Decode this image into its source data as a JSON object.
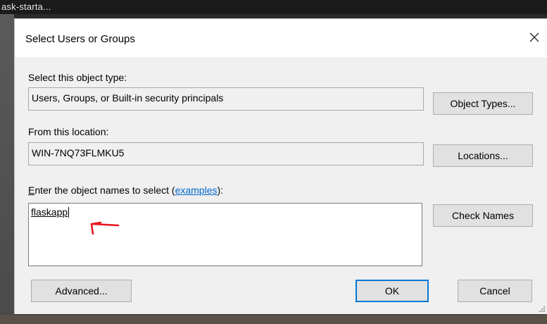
{
  "background": {
    "window_title": "ask-starta..."
  },
  "dialog": {
    "title": "Select Users or Groups",
    "close_icon": "close-icon",
    "object_type": {
      "label": "Select this object type:",
      "value": "Users, Groups, or Built-in security principals",
      "button": "Object Types..."
    },
    "location": {
      "label": "From this location:",
      "value": "WIN-7NQ73FLMKU5",
      "button": "Locations..."
    },
    "names": {
      "label_prefix": "E",
      "label_rest": "nter the object names to select (",
      "link": "examples",
      "label_suffix": "):",
      "value": "flaskapp",
      "button": "Check Names"
    },
    "buttons": {
      "advanced": "Advanced...",
      "ok": "OK",
      "cancel": "Cancel"
    },
    "accent_color": "#0078d7",
    "annotation_color": "#e8141b",
    "annotation_icon": "red-arrow-icon"
  }
}
